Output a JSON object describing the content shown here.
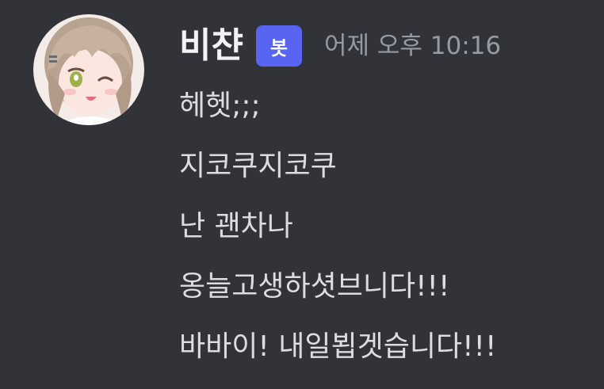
{
  "message": {
    "author": {
      "username": "비챤",
      "badge": "봇",
      "avatar_icon": "anime-girl-avatar"
    },
    "timestamp": "어제 오후 10:16",
    "lines": [
      "헤헷;;;",
      "지코쿠지코쿠",
      "난 괜차나",
      "옹늘고생하셧브니다!!!",
      "바바이! 내일뵙겟습니다!!!"
    ]
  },
  "colors": {
    "background": "#313338",
    "username": "#f2f3f5",
    "badge": "#5865f2",
    "timestamp": "#949ba4",
    "text": "#dbdee1"
  }
}
